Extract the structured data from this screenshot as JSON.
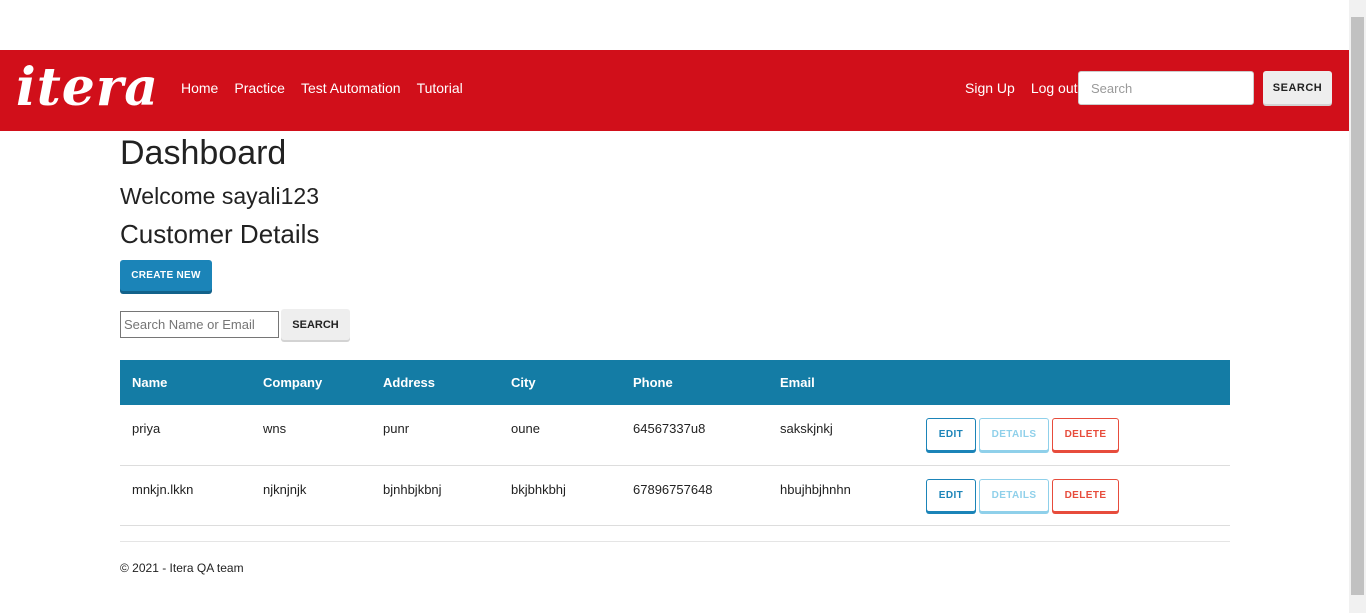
{
  "brand": {
    "logo_text": "itera"
  },
  "nav": {
    "links": [
      "Home",
      "Practice",
      "Test Automation",
      "Tutorial"
    ],
    "right_links": [
      "Sign Up",
      "Log out"
    ],
    "search_placeholder": "Search",
    "search_button": "SEARCH"
  },
  "main": {
    "title": "Dashboard",
    "welcome": "Welcome sayali123",
    "section_title": "Customer Details",
    "create_button": "CREATE NEW",
    "search_placeholder": "Search Name or Email",
    "search_button": "SEARCH"
  },
  "table": {
    "headers": [
      "Name",
      "Company",
      "Address",
      "City",
      "Phone",
      "Email"
    ],
    "rows": [
      {
        "cells": [
          "priya",
          "wns",
          "punr",
          "oune",
          "64567337u8",
          "sakskjnkj"
        ]
      },
      {
        "cells": [
          "mnkjn.lkkn",
          "njknjnjk",
          "bjnhbjkbnj",
          "bkjbhkbhj",
          "67896757648",
          "hbujhbjhnhn"
        ]
      }
    ],
    "actions": {
      "edit": "EDIT",
      "details": "DETAILS",
      "delete": "DELETE"
    }
  },
  "footer": {
    "text": "© 2021 - Itera QA team"
  },
  "colors": {
    "brand_red": "#d10f1a",
    "header_blue": "#147ca5",
    "primary_blue": "#1b84b8",
    "danger": "#e74c3c"
  }
}
